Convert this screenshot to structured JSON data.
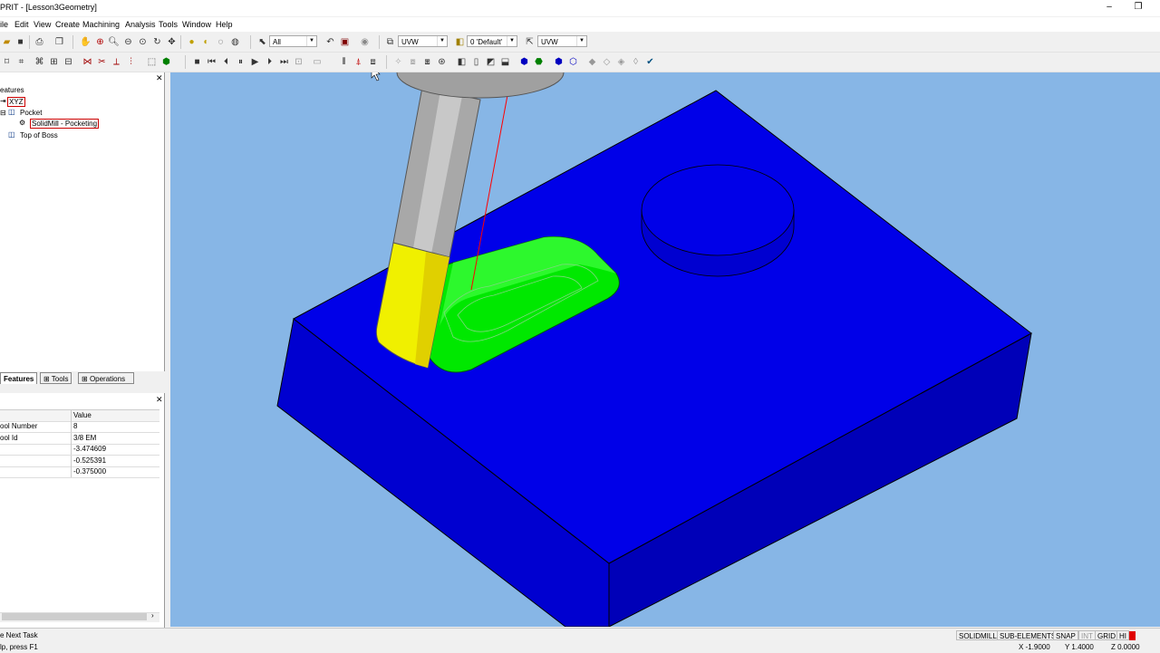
{
  "window": {
    "title": "PRIT - [Lesson3Geometry]",
    "minimize_glyph": "–",
    "restore_glyph": "❐"
  },
  "menu": [
    "ile",
    "Edit",
    "View",
    "Create",
    "Machining",
    "Analysis",
    "Tools",
    "Window",
    "Help"
  ],
  "toolbar": {
    "filter_value": "All",
    "workplane_value": "UVW",
    "layer_value": "0 'Default'",
    "workplane2_value": "UVW"
  },
  "tree": {
    "header": "eatures",
    "root": "XYZ",
    "pocket": "Pocket",
    "operation": "SolidMill - Pocketing",
    "boss": "Top of Boss"
  },
  "tabs": [
    "Features",
    "Tools",
    "Operations"
  ],
  "properties": {
    "header_value": "Value",
    "rows": [
      {
        "name": "ool Number",
        "value": "8"
      },
      {
        "name": "ool Id",
        "value": "3/8 EM"
      },
      {
        "name": "",
        "value": "-3.474609"
      },
      {
        "name": "",
        "value": "-0.525391"
      },
      {
        "name": "",
        "value": "-0.375000"
      }
    ]
  },
  "status": {
    "line1": "e Next Task",
    "line2": "lp, press F1",
    "panes": [
      "SOLIDMILL",
      "SUB-ELEMENTS",
      "SNAP",
      "INT",
      "GRID",
      "HI"
    ],
    "coord_x": "X -1.9000",
    "coord_y": "Y 1.4000",
    "coord_z": "Z 0.0000"
  },
  "colors": {
    "viewport_bg": "#87b6e6",
    "part": "#0000e8",
    "part_side_left": "#0000d0",
    "part_side_front": "#0000b8",
    "pocket": "#00e800",
    "tool_flutes": "#f0f000",
    "tool_shank": "#a8a8a8",
    "toolpath_line": "#ff0000"
  }
}
